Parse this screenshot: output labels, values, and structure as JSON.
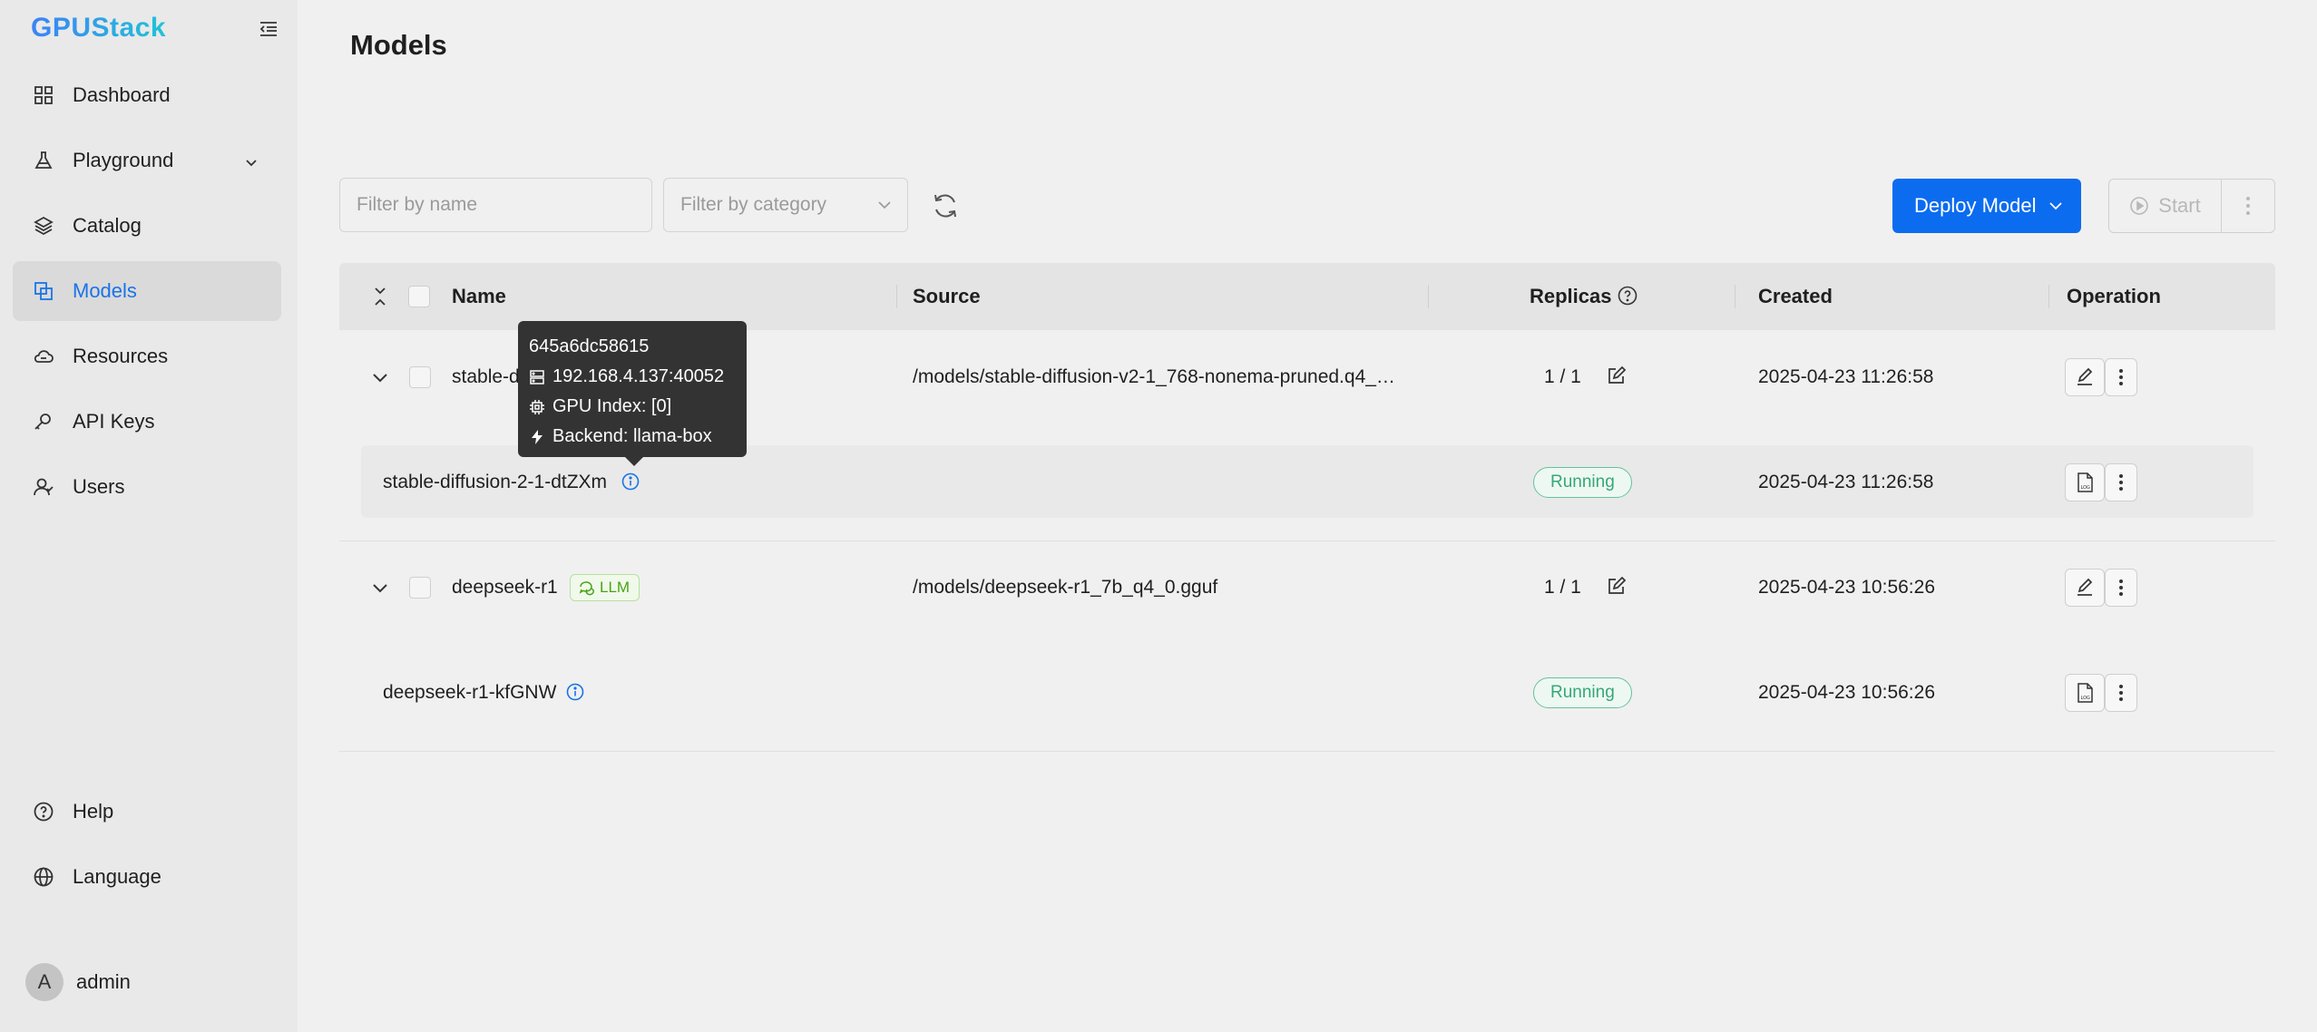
{
  "app": {
    "logo": "GPUStack"
  },
  "sidebar": {
    "items": [
      {
        "label": "Dashboard"
      },
      {
        "label": "Playground"
      },
      {
        "label": "Catalog"
      },
      {
        "label": "Models"
      },
      {
        "label": "Resources"
      },
      {
        "label": "API Keys"
      },
      {
        "label": "Users"
      }
    ],
    "bottom": [
      {
        "label": "Help"
      },
      {
        "label": "Language"
      }
    ],
    "user": {
      "initial": "A",
      "name": "admin"
    }
  },
  "page": {
    "title": "Models"
  },
  "toolbar": {
    "filter_name_placeholder": "Filter by name",
    "filter_category_placeholder": "Filter by category",
    "deploy_label": "Deploy Model",
    "start_label": "Start"
  },
  "table": {
    "headers": {
      "name": "Name",
      "source": "Source",
      "replicas": "Replicas",
      "created": "Created",
      "operation": "Operation"
    },
    "rows": [
      {
        "name": "stable-d",
        "source": "/models/stable-diffusion-v2-1_768-nonema-pruned.q4_…",
        "replicas": "1 / 1",
        "created": "2025-04-23 11:26:58",
        "instance": {
          "name": "stable-diffusion-2-1-dtZXm",
          "status": "Running",
          "created": "2025-04-23 11:26:58"
        }
      },
      {
        "name": "deepseek-r1",
        "tag": "LLM",
        "source": "/models/deepseek-r1_7b_q4_0.gguf",
        "replicas": "1 / 1",
        "created": "2025-04-23 10:56:26",
        "instance": {
          "name": "deepseek-r1-kfGNW",
          "status": "Running",
          "created": "2025-04-23 10:56:26"
        }
      }
    ]
  },
  "tooltip": {
    "id": "645a6dc58615",
    "address": "192.168.4.137:40052",
    "gpu": "GPU Index: [0]",
    "backend": "Backend: llama-box"
  },
  "colors": {
    "primary": "#0b6cf0",
    "running": "#35a876",
    "llm": "#4aa316"
  }
}
